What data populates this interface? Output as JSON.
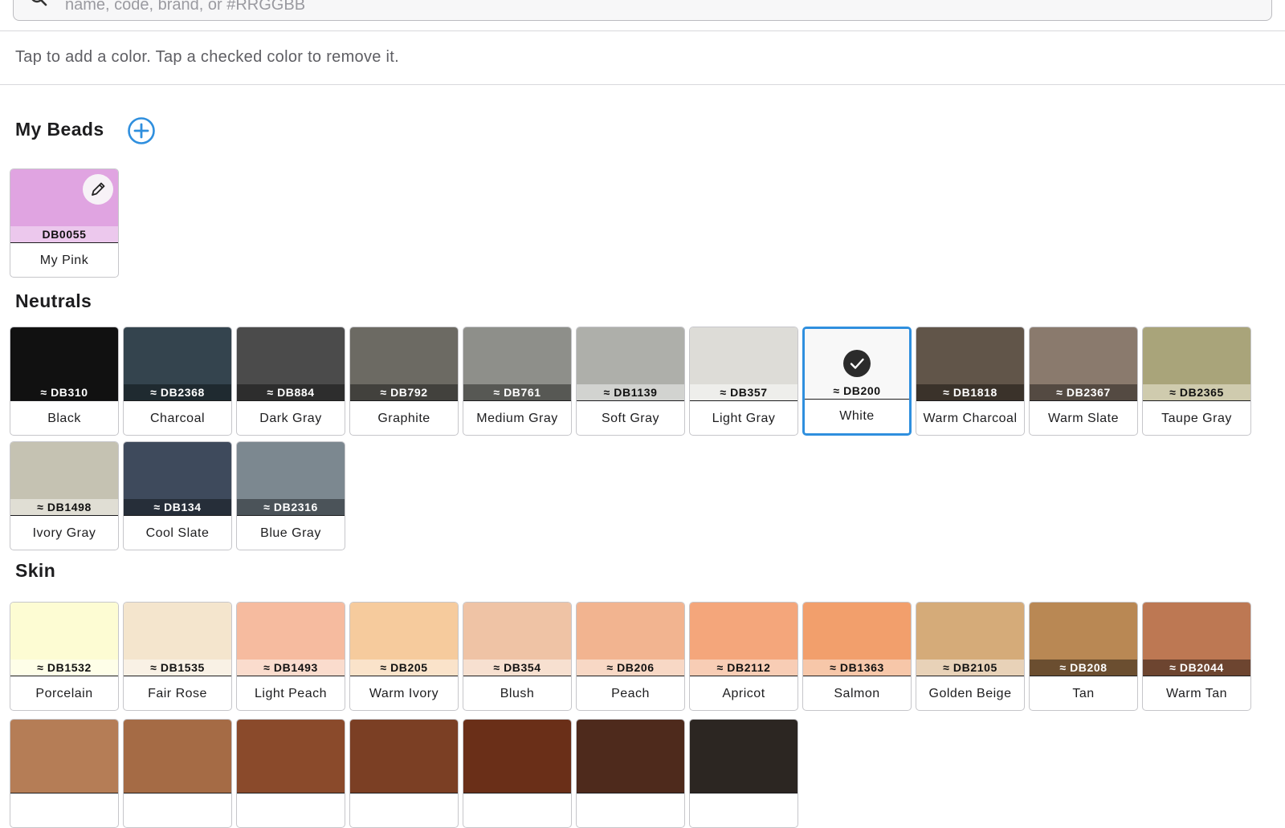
{
  "search": {
    "placeholder": "name, code, brand, or #RRGGBB",
    "value": ""
  },
  "hint": "Tap to add a color. Tap a checked color to remove it.",
  "my_beads": {
    "title": "My Beads",
    "add_icon": "plus-circle-icon",
    "edit_icon": "pencil-icon",
    "items": [
      {
        "code": "DB0055",
        "name": "My Pink",
        "color": "#e0a4e1",
        "code_bg": "#ecc8ed",
        "code_fg": "#111111"
      }
    ]
  },
  "sections": [
    {
      "title": "Neutrals",
      "items": [
        {
          "code": "≈ DB310",
          "name": "Black",
          "color": "#111111",
          "code_bg": "#111111",
          "code_fg": "#ffffff"
        },
        {
          "code": "≈ DB2368",
          "name": "Charcoal",
          "color": "#34444e",
          "code_bg": "#1f2a30",
          "code_fg": "#ffffff"
        },
        {
          "code": "≈ DB884",
          "name": "Dark Gray",
          "color": "#4b4b4b",
          "code_bg": "#2d2d2d",
          "code_fg": "#ffffff"
        },
        {
          "code": "≈ DB792",
          "name": "Graphite",
          "color": "#6c6a63",
          "code_bg": "#42413d",
          "code_fg": "#ffffff"
        },
        {
          "code": "≈ DB761",
          "name": "Medium Gray",
          "color": "#8e8f8a",
          "code_bg": "#575854",
          "code_fg": "#ffffff"
        },
        {
          "code": "≈ DB1139",
          "name": "Soft Gray",
          "color": "#aeafaa",
          "code_bg": "#d2d3d0",
          "code_fg": "#111111"
        },
        {
          "code": "≈ DB357",
          "name": "Light Gray",
          "color": "#dddcd7",
          "code_bg": "#eeeeeb",
          "code_fg": "#111111"
        },
        {
          "code": "≈ DB200",
          "name": "White",
          "color": "#f8f8f8",
          "code_bg": "#f8f8f8",
          "code_fg": "#111111",
          "selected": true,
          "check_icon": "check-icon"
        },
        {
          "code": "≈ DB1818",
          "name": "Warm Charcoal",
          "color": "#615549",
          "code_bg": "#3a322a",
          "code_fg": "#ffffff"
        },
        {
          "code": "≈ DB2367",
          "name": "Warm Slate",
          "color": "#8a7a6d",
          "code_bg": "#544a42",
          "code_fg": "#ffffff"
        },
        {
          "code": "≈ DB2365",
          "name": "Taupe Gray",
          "color": "#a9a47a",
          "code_bg": "#cfcbae",
          "code_fg": "#111111"
        },
        {
          "code": "≈ DB1498",
          "name": "Ivory Gray",
          "color": "#c5c2b2",
          "code_bg": "#e0ded4",
          "code_fg": "#111111"
        },
        {
          "code": "≈ DB134",
          "name": "Cool Slate",
          "color": "#3e4a5c",
          "code_bg": "#262e39",
          "code_fg": "#ffffff"
        },
        {
          "code": "≈ DB2316",
          "name": "Blue Gray",
          "color": "#7c8890",
          "code_bg": "#4b5359",
          "code_fg": "#ffffff"
        }
      ]
    },
    {
      "title": "Skin",
      "items": [
        {
          "code": "≈ DB1532",
          "name": "Porcelain",
          "color": "#fdfcd3",
          "code_bg": "#fefee8",
          "code_fg": "#111111"
        },
        {
          "code": "≈ DB1535",
          "name": "Fair Rose",
          "color": "#f4e5cd",
          "code_bg": "#f9f1e5",
          "code_fg": "#111111"
        },
        {
          "code": "≈ DB1493",
          "name": "Light Peach",
          "color": "#f6bb9f",
          "code_bg": "#fadccd",
          "code_fg": "#111111"
        },
        {
          "code": "≈ DB205",
          "name": "Warm Ivory",
          "color": "#f6cb9d",
          "code_bg": "#fae3ca",
          "code_fg": "#111111"
        },
        {
          "code": "≈ DB354",
          "name": "Blush",
          "color": "#efc3a5",
          "code_bg": "#f7e0d0",
          "code_fg": "#111111"
        },
        {
          "code": "≈ DB206",
          "name": "Peach",
          "color": "#f2b490",
          "code_bg": "#f8d8c5",
          "code_fg": "#111111"
        },
        {
          "code": "≈ DB2112",
          "name": "Apricot",
          "color": "#f4a67b",
          "code_bg": "#f8cdb5",
          "code_fg": "#111111"
        },
        {
          "code": "≈ DB1363",
          "name": "Salmon",
          "color": "#f29f6c",
          "code_bg": "#f7c7a9",
          "code_fg": "#111111"
        },
        {
          "code": "≈ DB2105",
          "name": "Golden Beige",
          "color": "#d5ab79",
          "code_bg": "#e8d2b8",
          "code_fg": "#111111"
        },
        {
          "code": "≈ DB208",
          "name": "Tan",
          "color": "#b98854",
          "code_bg": "#6b4e30",
          "code_fg": "#ffffff"
        },
        {
          "code": "≈ DB2044",
          "name": "Warm Tan",
          "color": "#bd7853",
          "code_bg": "#6d4530",
          "code_fg": "#ffffff"
        }
      ]
    }
  ],
  "partial_row_colors": [
    "#b57d56",
    "#a56b45",
    "#8a4a2b",
    "#7b3f24",
    "#6a2f18",
    "#4e2a1c",
    "#2c2622"
  ],
  "colors": {
    "accent": "#2f8fde",
    "border": "#c6c6ca",
    "divider": "#d8d8dc"
  }
}
